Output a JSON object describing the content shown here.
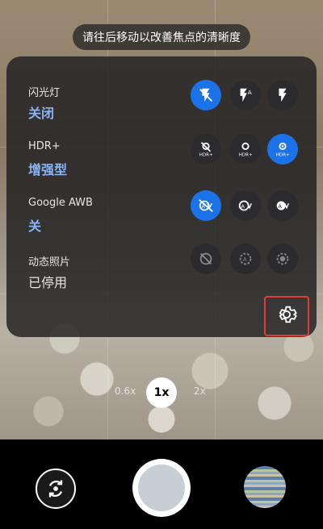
{
  "toast": {
    "text": "请往后移动以改善焦点的清晰度"
  },
  "settings": {
    "rows": [
      {
        "label": "闪光灯",
        "value": "关闭"
      },
      {
        "label": "HDR+",
        "value": "增强型"
      },
      {
        "label": "Google AWB",
        "value": "关"
      },
      {
        "label": "动态照片",
        "value": "已停用"
      }
    ],
    "icons": {
      "flash": [
        "flash-off-icon",
        "flash-auto-icon",
        "flash-on-icon"
      ],
      "hdr": [
        "hdr-off-icon",
        "hdr-plus-icon",
        "hdr-plus-enhanced-icon"
      ],
      "awb": [
        "awb-off-icon",
        "awb-auto-icon",
        "awb-on-icon"
      ],
      "motion": [
        "motion-off-icon",
        "motion-auto-icon",
        "motion-on-icon"
      ]
    },
    "selected_color": "#1a73e8",
    "value_color": "#8ab4f8"
  },
  "zoom": {
    "left": "0.6x",
    "current": "1x",
    "right": "2x"
  },
  "colors": {
    "highlight_border": "#e53935"
  }
}
